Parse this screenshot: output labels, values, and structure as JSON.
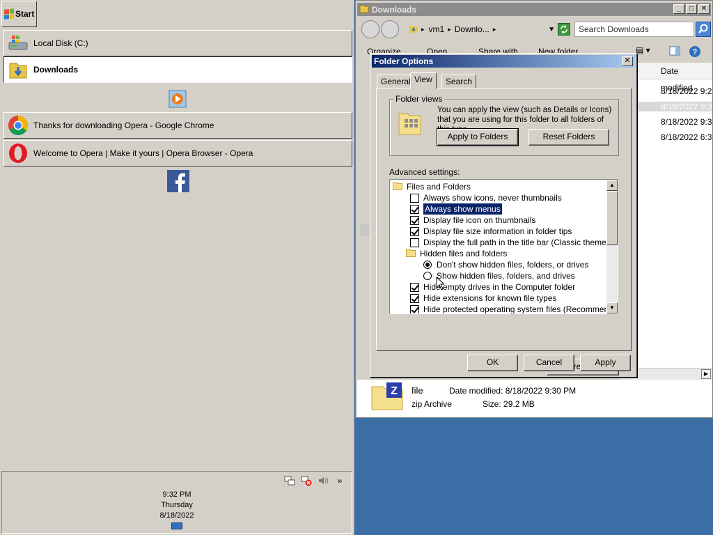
{
  "taskbar": {
    "start_label": "Start",
    "windows": [
      {
        "label": "Local Disk (C:)",
        "active": false
      },
      {
        "label": "Downloads",
        "active": true
      },
      {
        "label": "Thanks for downloading Opera - Google Chrome",
        "active": false
      },
      {
        "label": "Welcome to Opera | Make it yours | Opera Browser - Opera",
        "active": false
      }
    ],
    "quick_launch": [
      "media-player-icon",
      "facebook-icon"
    ],
    "tray": {
      "icons": [
        "network-icon",
        "network-error-icon",
        "volume-icon",
        "show-more-icon"
      ],
      "show_more": "»",
      "time": "9:32 PM",
      "day": "Thursday",
      "date": "8/18/2022"
    }
  },
  "explorer": {
    "title": "Downloads",
    "breadcrumb": [
      "vm1",
      "Downlo..."
    ],
    "breadcrumb_sep": "▸",
    "search_placeholder": "Search Downloads",
    "toolbar": [
      "Organize",
      "Open",
      "Share with",
      "New folder"
    ],
    "column_header": "Date modified",
    "rows": [
      "8/18/2022 9:2",
      "8/18/2022 9:3",
      "8/18/2022 9:3",
      "8/18/2022 6:3"
    ],
    "details": {
      "name": "file",
      "type": "zip Archive",
      "date_label": "Date modified:",
      "date_value": "8/18/2022 9:30 PM",
      "size_label": "Size:",
      "size_value": "29.2 MB"
    }
  },
  "dialog": {
    "title": "Folder Options",
    "tabs": [
      "General",
      "View",
      "Search"
    ],
    "selected_tab": "View",
    "folder_views": {
      "legend": "Folder views",
      "description": "You can apply the view (such as Details or Icons) that you are using for this folder to all folders of this type.",
      "apply_button": "Apply to Folders",
      "reset_button": "Reset Folders"
    },
    "advanced_label": "Advanced settings:",
    "tree": [
      {
        "type": "folder",
        "label": "Files and Folders",
        "indent": 0
      },
      {
        "type": "check",
        "label": "Always show icons, never thumbnails",
        "checked": false,
        "indent": 1
      },
      {
        "type": "check",
        "label": "Always show menus",
        "checked": true,
        "indent": 1,
        "selected": true
      },
      {
        "type": "check",
        "label": "Display file icon on thumbnails",
        "checked": true,
        "indent": 1
      },
      {
        "type": "check",
        "label": "Display file size information in folder tips",
        "checked": true,
        "indent": 1
      },
      {
        "type": "check",
        "label": "Display the full path in the title bar (Classic theme only)",
        "checked": false,
        "indent": 1
      },
      {
        "type": "folder",
        "label": "Hidden files and folders",
        "indent": 1
      },
      {
        "type": "radio",
        "label": "Don't show hidden files, folders, or drives",
        "checked": true,
        "indent": 2
      },
      {
        "type": "radio",
        "label": "Show hidden files, folders, and drives",
        "checked": false,
        "indent": 2
      },
      {
        "type": "check",
        "label": "Hide empty drives in the Computer folder",
        "checked": true,
        "indent": 1
      },
      {
        "type": "check",
        "label": "Hide extensions for known file types",
        "checked": true,
        "indent": 1
      },
      {
        "type": "check",
        "label": "Hide protected operating system files (Recommended)",
        "checked": true,
        "indent": 1
      }
    ],
    "restore_defaults": "Restore Defaults",
    "ok": "OK",
    "cancel": "Cancel",
    "apply": "Apply"
  },
  "colors": {
    "desktop": "#3a6ea5",
    "face": "#d4d0c8",
    "selection": "#0a246a"
  }
}
